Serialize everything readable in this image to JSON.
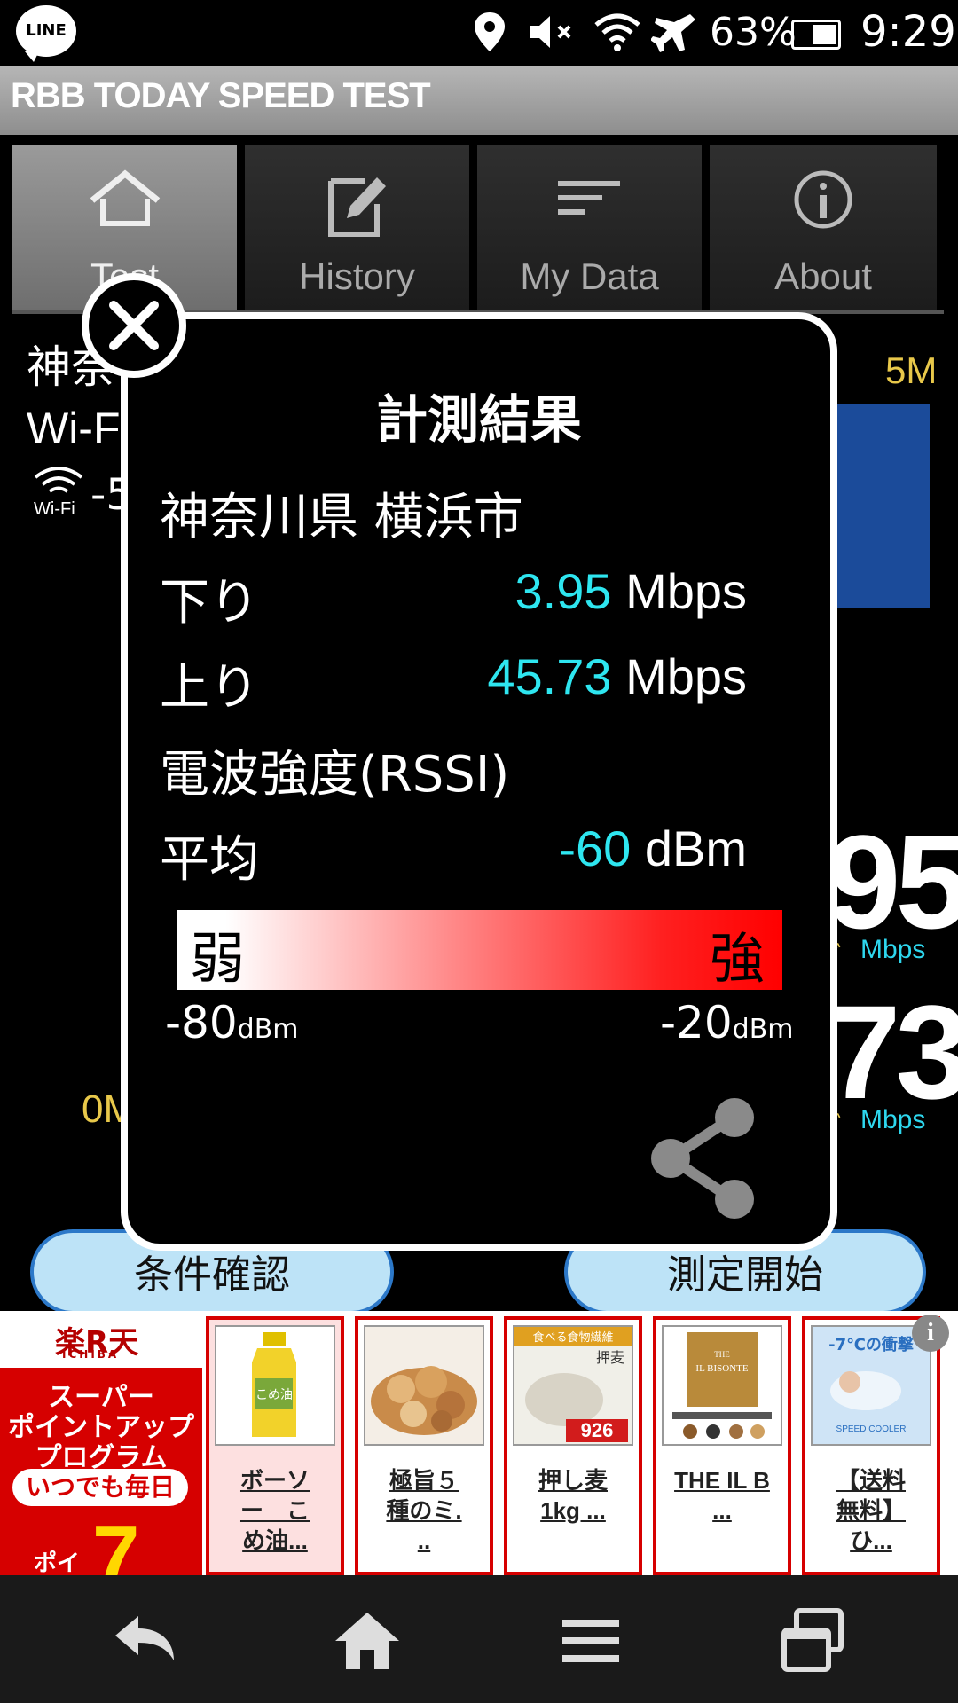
{
  "status_bar": {
    "app_badge": "LINE",
    "battery": "63%",
    "time": "9:29",
    "icons": [
      "location-icon",
      "mute-icon",
      "wifi-icon",
      "airplane-icon",
      "battery-icon"
    ]
  },
  "app": {
    "title": "RBB TODAY SPEED TEST"
  },
  "tabs": [
    {
      "label": "Test",
      "icon": "home-icon",
      "active": true
    },
    {
      "label": "History",
      "icon": "edit-icon",
      "active": false
    },
    {
      "label": "My Data",
      "icon": "list-icon",
      "active": false
    },
    {
      "label": "About",
      "icon": "info-icon",
      "active": false
    }
  ],
  "background": {
    "location_partial": "神奈",
    "connection_partial": "Wi-F",
    "wifi_label": "Wi-Fi",
    "rssi_partial": "-5",
    "gauge_max": "5M",
    "gauge_min": "0M",
    "down_big_partial": "95",
    "up_big_partial": "73",
    "down_unit": "Mbps",
    "up_unit": "Mbps",
    "btn_conditions": "条件確認",
    "btn_start": "測定開始"
  },
  "modal": {
    "title": "計測結果",
    "location": "神奈川県 横浜市",
    "download_label": "下り",
    "download_value": "3.95",
    "download_unit": "Mbps",
    "upload_label": "上り",
    "upload_value": "45.73",
    "upload_unit": "Mbps",
    "rssi_label": "電波強度(RSSI)",
    "avg_label": "平均",
    "avg_value": "-60",
    "avg_unit": "dBm",
    "meter_weak": "弱",
    "meter_strong": "強",
    "scale_min_num": "-80",
    "scale_min_unit": "dBm",
    "scale_max_num": "-20",
    "scale_max_unit": "dBm"
  },
  "ad": {
    "rakuten_logo": "楽R天",
    "rakuten_sub": "ICHIBA",
    "promo_line1": "スーパー",
    "promo_line2": "ポイントアップ",
    "promo_line3": "プログラム",
    "promo_pill": "いつでも毎日",
    "promo_poi": "ポイ",
    "promo_num": "7",
    "items": [
      {
        "text_lines": [
          "ボーソ",
          "ー　こ",
          "め油..."
        ]
      },
      {
        "text_lines": [
          "極旨５",
          "種のミ.",
          ".."
        ]
      },
      {
        "text_lines": [
          "押し麦",
          "1kg ..."
        ]
      },
      {
        "text_lines": [
          "THE IL B",
          "..."
        ]
      },
      {
        "text_lines": [
          "【送料",
          "無料】",
          "ひ..."
        ]
      }
    ],
    "item_image_texts": {
      "oil": "こめ油",
      "barley_top": "食べる食物繊維",
      "barley_name": "押麦",
      "barley_price": "926",
      "book_title": "IL BISONTE",
      "book_sub": "THE",
      "cooler_title": "-7℃の衝撃",
      "cooler_sub": "SPEED COOLER"
    }
  },
  "colors": {
    "accent_cyan": "#2ee6f0",
    "gauge_yellow": "#e8c84a",
    "gauge_blue": "#1b4b9a",
    "button_fill": "#bde3f7",
    "button_border": "#2c78c8",
    "rakuten_red": "#d60000"
  }
}
